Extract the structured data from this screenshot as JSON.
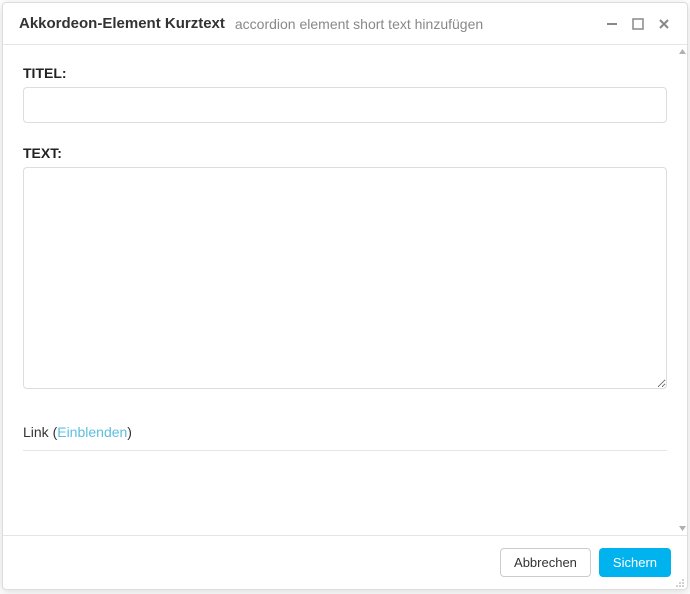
{
  "header": {
    "title": "Akkordeon-Element Kurztext",
    "subtitle": "accordion element short text hinzufügen"
  },
  "form": {
    "title_label": "TITEL:",
    "title_value": "",
    "text_label": "TEXT:",
    "text_value": "",
    "link_prefix": "Link (",
    "link_toggle": "Einblenden",
    "link_suffix": ")"
  },
  "footer": {
    "cancel_label": "Abbrechen",
    "save_label": "Sichern"
  }
}
